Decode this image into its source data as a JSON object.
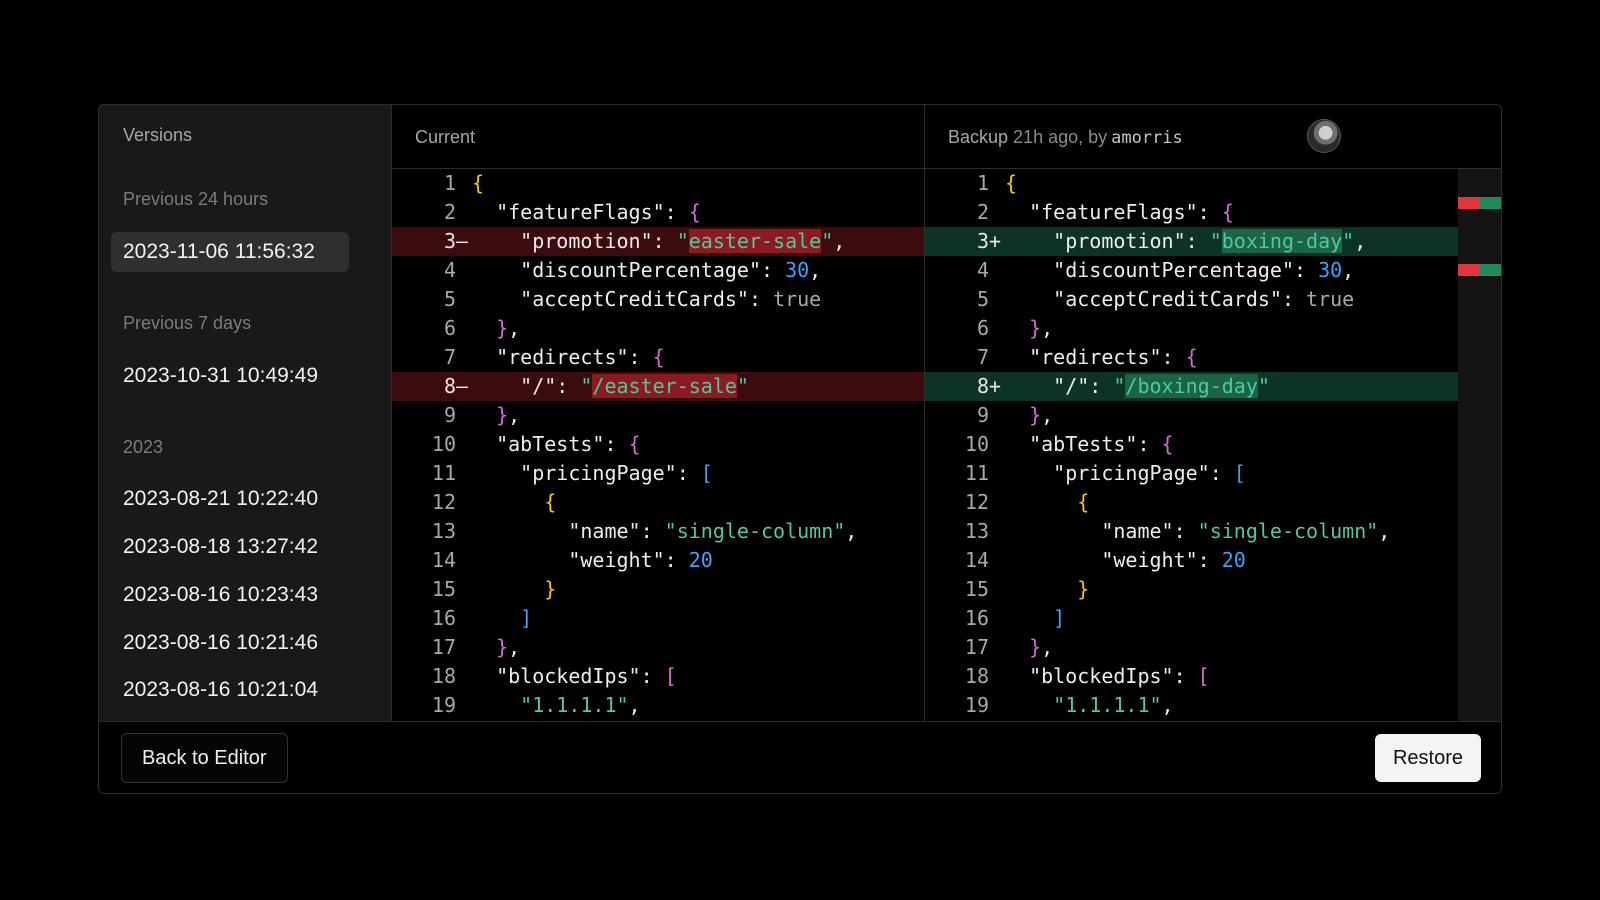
{
  "sidebar": {
    "title": "Versions",
    "sections": [
      {
        "label": "Previous 24 hours",
        "items": [
          "2023-11-06 11:56:32"
        ]
      },
      {
        "label": "Previous 7 days",
        "items": [
          "2023-10-31 10:49:49"
        ]
      },
      {
        "label": "2023",
        "items": [
          "2023-08-21 10:22:40",
          "2023-08-18 13:27:42",
          "2023-08-16 10:23:43",
          "2023-08-16 10:21:46",
          "2023-08-16 10:21:04"
        ]
      }
    ],
    "selected": "2023-11-06 11:56:32"
  },
  "current_pane": {
    "title": "Current"
  },
  "backup_pane": {
    "title": "Backup",
    "meta": "21h ago, by",
    "user": "amorris"
  },
  "colors": {
    "deleted_line": "#3c0b0e",
    "deleted_highlight": "#8e1a21",
    "added_line": "#0d3325",
    "added_highlight": "#1b6446",
    "key_brace": "#f5c518",
    "string": "#4ec9a0",
    "number": "#3fa2f2"
  },
  "diff": {
    "left": [
      {
        "n": "1",
        "m": "",
        "text": "{"
      },
      {
        "n": "2",
        "m": "",
        "text": "  \"featureFlags\": {"
      },
      {
        "n": "3",
        "m": "–",
        "text": "    \"promotion\": \"easter-sale\",",
        "type": "del"
      },
      {
        "n": "4",
        "m": "",
        "text": "    \"discountPercentage\": 30,"
      },
      {
        "n": "5",
        "m": "",
        "text": "    \"acceptCreditCards\": true"
      },
      {
        "n": "6",
        "m": "",
        "text": "  },"
      },
      {
        "n": "7",
        "m": "",
        "text": "  \"redirects\": {"
      },
      {
        "n": "8",
        "m": "–",
        "text": "    \"/\": \"/easter-sale\"",
        "type": "del"
      },
      {
        "n": "9",
        "m": "",
        "text": "  },"
      },
      {
        "n": "10",
        "m": "",
        "text": "  \"abTests\": {"
      },
      {
        "n": "11",
        "m": "",
        "text": "    \"pricingPage\": ["
      },
      {
        "n": "12",
        "m": "",
        "text": "      {"
      },
      {
        "n": "13",
        "m": "",
        "text": "        \"name\": \"single-column\","
      },
      {
        "n": "14",
        "m": "",
        "text": "        \"weight\": 20"
      },
      {
        "n": "15",
        "m": "",
        "text": "      }"
      },
      {
        "n": "16",
        "m": "",
        "text": "    ]"
      },
      {
        "n": "17",
        "m": "",
        "text": "  },"
      },
      {
        "n": "18",
        "m": "",
        "text": "  \"blockedIps\": ["
      },
      {
        "n": "19",
        "m": "",
        "text": "    \"1.1.1.1\","
      }
    ],
    "right": [
      {
        "n": "1",
        "m": "",
        "text": "{"
      },
      {
        "n": "2",
        "m": "",
        "text": "  \"featureFlags\": {"
      },
      {
        "n": "3",
        "m": "+",
        "text": "    \"promotion\": \"boxing-day\",",
        "type": "add"
      },
      {
        "n": "4",
        "m": "",
        "text": "    \"discountPercentage\": 30,"
      },
      {
        "n": "5",
        "m": "",
        "text": "    \"acceptCreditCards\": true"
      },
      {
        "n": "6",
        "m": "",
        "text": "  },"
      },
      {
        "n": "7",
        "m": "",
        "text": "  \"redirects\": {"
      },
      {
        "n": "8",
        "m": "+",
        "text": "    \"/\": \"/boxing-day\"",
        "type": "add"
      },
      {
        "n": "9",
        "m": "",
        "text": "  },"
      },
      {
        "n": "10",
        "m": "",
        "text": "  \"abTests\": {"
      },
      {
        "n": "11",
        "m": "",
        "text": "    \"pricingPage\": ["
      },
      {
        "n": "12",
        "m": "",
        "text": "      {"
      },
      {
        "n": "13",
        "m": "",
        "text": "        \"name\": \"single-column\","
      },
      {
        "n": "14",
        "m": "",
        "text": "        \"weight\": 20"
      },
      {
        "n": "15",
        "m": "",
        "text": "      }"
      },
      {
        "n": "16",
        "m": "",
        "text": "    ]"
      },
      {
        "n": "17",
        "m": "",
        "text": "  },"
      },
      {
        "n": "18",
        "m": "",
        "text": "  \"blockedIps\": ["
      },
      {
        "n": "19",
        "m": "",
        "text": "    \"1.1.1.1\","
      }
    ],
    "highlights": {
      "left": {
        "3": "easter-sale",
        "8": "/easter-sale"
      },
      "right": {
        "3": "boxing-day",
        "8": "/boxing-day"
      }
    }
  },
  "footer": {
    "back_label": "Back to Editor",
    "restore_label": "Restore"
  }
}
